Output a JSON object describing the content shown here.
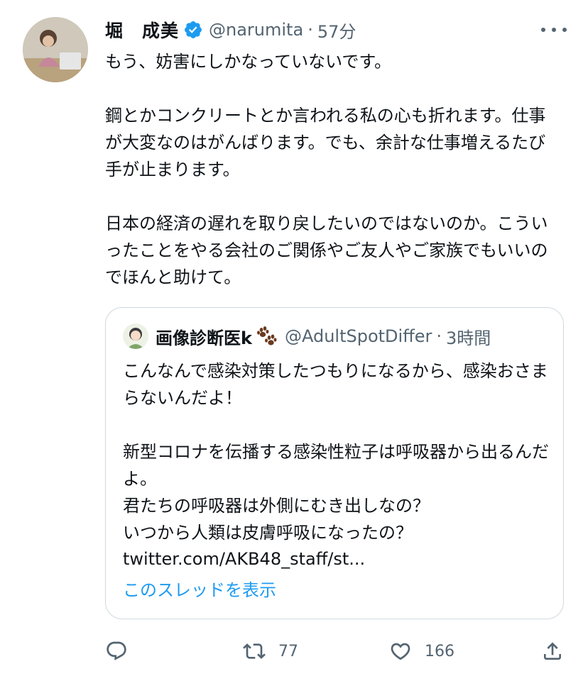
{
  "author": {
    "name": "堀　成美",
    "handle": "@narumita",
    "time": "57分",
    "verified": true,
    "verified_color": "#1d9bf0"
  },
  "tweet": {
    "text": "もう、妨害にしかなっていないです。\n\n鋼とかコンクリートとか言われる私の心も折れます。仕事が大変なのはがんばります。でも、余計な仕事増えるたび手が止まります。\n\n日本の経済の遅れを取り戻したいのではないのか。こういったことをやる会社のご関係やご友人やご家族でもいいのでほんと助けて。"
  },
  "quoted": {
    "name": "画像診断医k",
    "name_emoji": "paw-prints-icon",
    "handle": "@AdultSpotDiffer",
    "time": "3時間",
    "text": "こんなんで感染対策したつもりになるから、感染おさまらないんだよ！\n\n新型コロナを伝播する感染性粒子は呼吸器から出るんだよ。\n君たちの呼吸器は外側にむき出しなの？\nいつから人類は皮膚呼吸になったの？",
    "link": "twitter.com/AKB48_staff/st...",
    "thread_label": "このスレッドを表示"
  },
  "actions": {
    "reply_icon": "reply-icon",
    "retweet_icon": "retweet-icon",
    "retweet_count": "77",
    "like_icon": "heart-icon",
    "like_count": "166",
    "share_icon": "share-icon"
  },
  "colors": {
    "text_primary": "#0f1419",
    "text_secondary": "#536471",
    "accent": "#1d9bf0",
    "border": "#cfd9de"
  }
}
